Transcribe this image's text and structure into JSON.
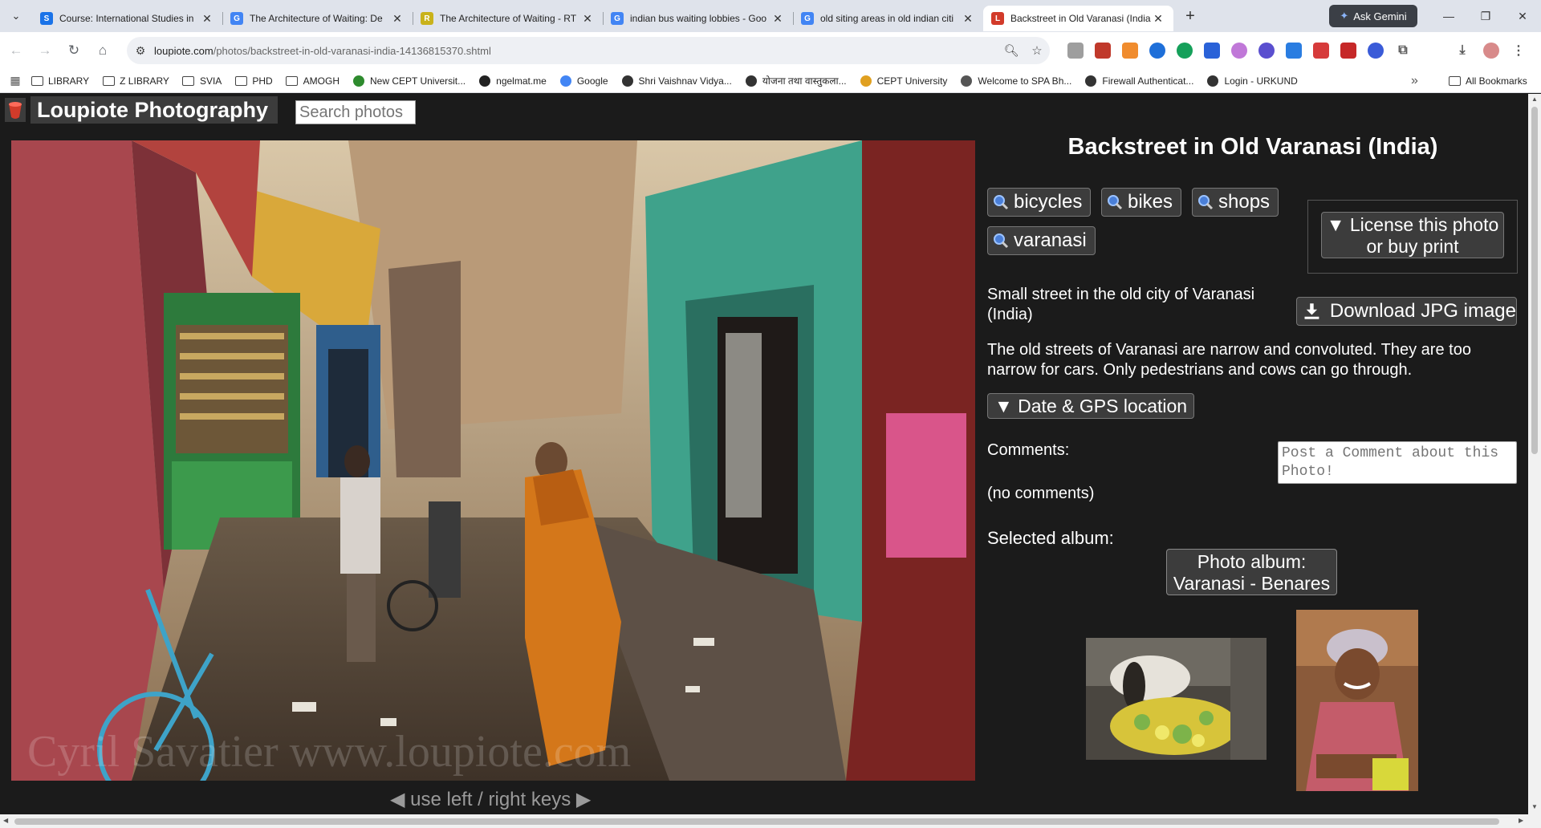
{
  "browser": {
    "tabs": [
      {
        "title": "Course: International Studies in",
        "fav_text": "S",
        "fav_color": "#1a73e8"
      },
      {
        "title": "The Architecture of Waiting: De",
        "fav_text": "G",
        "fav_color": "#4285f4"
      },
      {
        "title": "The Architecture of Waiting - RT",
        "fav_text": "R",
        "fav_color": "#c9b21a"
      },
      {
        "title": "indian bus waiting lobbies - Goo",
        "fav_text": "G",
        "fav_color": "#4285f4"
      },
      {
        "title": "old siting areas in old indian citi",
        "fav_text": "G",
        "fav_color": "#4285f4"
      },
      {
        "title": "Backstreet in Old Varanasi (India",
        "fav_text": "L",
        "fav_color": "#d23b2a"
      }
    ],
    "ask_gemini": "Ask Gemini",
    "url_domain": "loupiote.com",
    "url_path": "/photos/backstreet-in-old-varanasi-india-14136815370.shtml",
    "bookmarks": [
      {
        "label": "LIBRARY",
        "icon": "folder-icon"
      },
      {
        "label": "Z LIBRARY",
        "icon": "folder-icon"
      },
      {
        "label": "SVIA",
        "icon": "folder-icon"
      },
      {
        "label": "PHD",
        "icon": "folder-icon"
      },
      {
        "label": "AMOGH",
        "icon": "folder-icon"
      },
      {
        "label": "New CEPT Universit...",
        "icon": "site-icon",
        "color": "#2e8b2e"
      },
      {
        "label": "ngelmat.me",
        "icon": "site-icon",
        "color": "#222222"
      },
      {
        "label": "Google",
        "icon": "google-icon",
        "color": "#4285f4"
      },
      {
        "label": "Shri Vaishnav Vidya...",
        "icon": "site-icon",
        "color": "#333333"
      },
      {
        "label": "योजना तथा वास्तुकला...",
        "icon": "site-icon",
        "color": "#333333"
      },
      {
        "label": "CEPT University",
        "icon": "site-icon",
        "color": "#e0a020"
      },
      {
        "label": "Welcome to SPA Bh...",
        "icon": "site-icon",
        "color": "#555555"
      },
      {
        "label": "Firewall Authenticat...",
        "icon": "site-icon",
        "color": "#333333"
      },
      {
        "label": "Login - URKUND",
        "icon": "site-icon",
        "color": "#333333"
      }
    ],
    "all_bookmarks": "All Bookmarks",
    "overflow": "»"
  },
  "site": {
    "name": "Loupiote Photography",
    "search_placeholder": "Search photos"
  },
  "photo": {
    "title": "Backstreet in Old Varanasi (India)",
    "watermark": "Cyril Savatier  www.loupiote.com",
    "keys_hint": "◀ use left / right keys ▶",
    "tags": [
      "bicycles",
      "bikes",
      "shops",
      "varanasi"
    ],
    "license_label": "▼ License this photo or buy print",
    "download_label": "Download JPG image",
    "caption": "Small street in the old city of Varanasi (India)",
    "description": "The old streets of Varanasi are narrow and convoluted. They are too narrow for cars. Only pedestrians and cows can go through.",
    "gps_label": "▼ Date & GPS location",
    "comments_label": "Comments:",
    "comment_placeholder": "Post a Comment about this Photo!",
    "no_comments": "(no comments)",
    "selected_album_label": "Selected album:",
    "album_button": "Photo album: Varanasi - Benares"
  },
  "colors": {
    "page_bg": "#1b1b1b",
    "button_bg": "#3c3c3c",
    "accent": "#d23b2a"
  }
}
